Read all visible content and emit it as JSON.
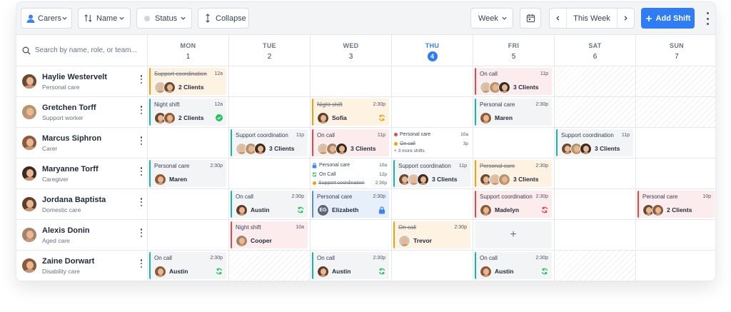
{
  "toolbar": {
    "carers_label": "Carers",
    "name_label": "Name",
    "status_label": "Status",
    "collapse_label": "Collapse",
    "view_label": "Week",
    "period_label": "This Week",
    "add_label": "Add Shift"
  },
  "search": {
    "placeholder": "Search by name, role, or team..."
  },
  "days": [
    {
      "name": "MON",
      "date": "1"
    },
    {
      "name": "TUE",
      "date": "2"
    },
    {
      "name": "WED",
      "date": "3"
    },
    {
      "name": "THU",
      "date": "4",
      "today": true
    },
    {
      "name": "FRI",
      "date": "5"
    },
    {
      "name": "SAT",
      "date": "6"
    },
    {
      "name": "SUN",
      "date": "7"
    }
  ],
  "people": [
    {
      "name": "Haylie Westervelt",
      "role": "Personal care",
      "avatar": "a1"
    },
    {
      "name": "Gretchen Torff",
      "role": "Support worker",
      "avatar": "a3"
    },
    {
      "name": "Marcus Siphron",
      "role": "Carer",
      "avatar": "a4"
    },
    {
      "name": "Maryanne Torff",
      "role": "Caregiver",
      "avatar": "a2"
    },
    {
      "name": "Jordana Baptista",
      "role": "Domestic care",
      "avatar": "a6"
    },
    {
      "name": "Alexis Donin",
      "role": "Aged care",
      "avatar": "a7"
    },
    {
      "name": "Zaine Dorwart",
      "role": "Disability care",
      "avatar": "a4"
    }
  ],
  "hatched": [
    [
      0,
      5
    ],
    [
      0,
      6
    ],
    [
      1,
      5
    ],
    [
      1,
      6
    ],
    [
      6,
      1
    ],
    [
      6,
      5
    ]
  ],
  "add_cells": [
    [
      5,
      4
    ]
  ],
  "shifts": [
    {
      "row": 0,
      "day": 0,
      "color": "orange",
      "title": "Support coordination",
      "strike": true,
      "time": "12a",
      "avatars": [
        "a5",
        "a1"
      ],
      "label": "2 Clients"
    },
    {
      "row": 0,
      "day": 4,
      "color": "red",
      "title": "On call",
      "time": "11p",
      "avatars": [
        "a5",
        "a3",
        "a2"
      ],
      "label": "3 Clients"
    },
    {
      "row": 1,
      "day": 0,
      "color": "teal",
      "title": "Night shift",
      "time": "12a",
      "avatars": [
        "a1",
        "a4"
      ],
      "label": "2 Clients",
      "status": "check-circle-icon"
    },
    {
      "row": 1,
      "day": 2,
      "color": "orange",
      "title": "Night shift",
      "strike": true,
      "time": "2:30p",
      "avatars": [
        "a6"
      ],
      "label": "Sofia",
      "status": "sync-icon"
    },
    {
      "row": 1,
      "day": 4,
      "color": "teal",
      "title": "Personal care",
      "time": "2:30p",
      "avatars": [
        "a4"
      ],
      "label": "Maren"
    },
    {
      "row": 2,
      "day": 1,
      "color": "teal",
      "title": "Support coordination",
      "time": "11p",
      "avatars": [
        "a5",
        "a3",
        "a2"
      ],
      "label": "3 Clients"
    },
    {
      "row": 2,
      "day": 2,
      "color": "red",
      "title": "On call",
      "time": "11p",
      "avatars": [
        "a5",
        "a7",
        "a2"
      ],
      "label": "3 Clients"
    },
    {
      "row": 2,
      "day": 5,
      "color": "teal",
      "title": "Support coordination",
      "time": "11p",
      "avatars": [
        "a1",
        "a3",
        "a2"
      ],
      "label": "3 Clients"
    },
    {
      "row": 3,
      "day": 0,
      "color": "teal",
      "title": "Personal care",
      "time": "2:30p",
      "avatars": [
        "a4"
      ],
      "label": "Maren"
    },
    {
      "row": 3,
      "day": 3,
      "color": "teal",
      "title": "Support coordination",
      "time": "11p",
      "avatars": [
        "a1",
        "a5",
        "a2"
      ],
      "label": "3 Clients"
    },
    {
      "row": 3,
      "day": 4,
      "color": "orange",
      "title": "Personal care",
      "strike": true,
      "time": "2:30p",
      "avatars": [
        "a1",
        "a5",
        "a3"
      ],
      "label": "3 Clients"
    },
    {
      "row": 4,
      "day": 1,
      "color": "teal",
      "title": "On call",
      "time": "2:30p",
      "avatars": [
        "a6"
      ],
      "label": "Austin",
      "status": "sync-icon"
    },
    {
      "row": 4,
      "day": 2,
      "color": "blue",
      "title": "Personal care",
      "time": "2:30p",
      "initials": "EG",
      "label": "Elizabeth",
      "status": "lock-icon"
    },
    {
      "row": 4,
      "day": 4,
      "color": "red",
      "title": "Support coordination",
      "time": "2:30p",
      "avatars": [
        "a4"
      ],
      "label": "Madelyn",
      "status": "sync-icon"
    },
    {
      "row": 4,
      "day": 6,
      "color": "red",
      "title": "Personal care",
      "time": "10p",
      "avatars": [
        "a1",
        "a4"
      ],
      "label": "2 Clients"
    },
    {
      "row": 5,
      "day": 1,
      "color": "red",
      "title": "Night shift",
      "time": "10a",
      "avatars": [
        "a7"
      ],
      "label": "Cooper"
    },
    {
      "row": 5,
      "day": 3,
      "color": "orange",
      "title": "On call",
      "strike": true,
      "time": "2:30p",
      "avatars": [
        "a5"
      ],
      "label": "Trevor"
    },
    {
      "row": 6,
      "day": 0,
      "color": "teal",
      "title": "On call",
      "time": "2:30p",
      "avatars": [
        "a4"
      ],
      "label": "Austin",
      "status": "sync-icon"
    },
    {
      "row": 6,
      "day": 2,
      "color": "teal",
      "title": "On call",
      "time": "2:30p",
      "avatars": [
        "a6"
      ],
      "label": "Austin",
      "status": "sync-icon"
    },
    {
      "row": 6,
      "day": 4,
      "color": "teal",
      "title": "On call",
      "time": "2:30p",
      "avatars": [
        "a4"
      ],
      "label": "Austin",
      "status": "sync-icon"
    }
  ],
  "compact": [
    {
      "row": 2,
      "day": 3,
      "items": [
        {
          "title": "Personal care",
          "time": "10a",
          "icon": "dot",
          "color": "#ef4444"
        },
        {
          "title": "On call",
          "time": "3p",
          "icon": "dot",
          "color": "#f59e0b",
          "strike": true
        }
      ],
      "more": "+ 3 more shifts"
    },
    {
      "row": 3,
      "day": 2,
      "items": [
        {
          "title": "Personal care",
          "time": "10a",
          "icon": "lock",
          "color": "#3b82f6"
        },
        {
          "title": "On Call",
          "time": "12p",
          "icon": "sync",
          "color": "#22c55e"
        },
        {
          "title": "Support coordination",
          "time": "2:30p",
          "icon": "dot",
          "color": "#f59e0b",
          "strike": true
        }
      ]
    }
  ],
  "colors": {
    "accent": "#2e7cf6",
    "teal": "#14b8a6",
    "orange": "#f59e0b",
    "red": "#ef4444",
    "green": "#22c55e"
  }
}
